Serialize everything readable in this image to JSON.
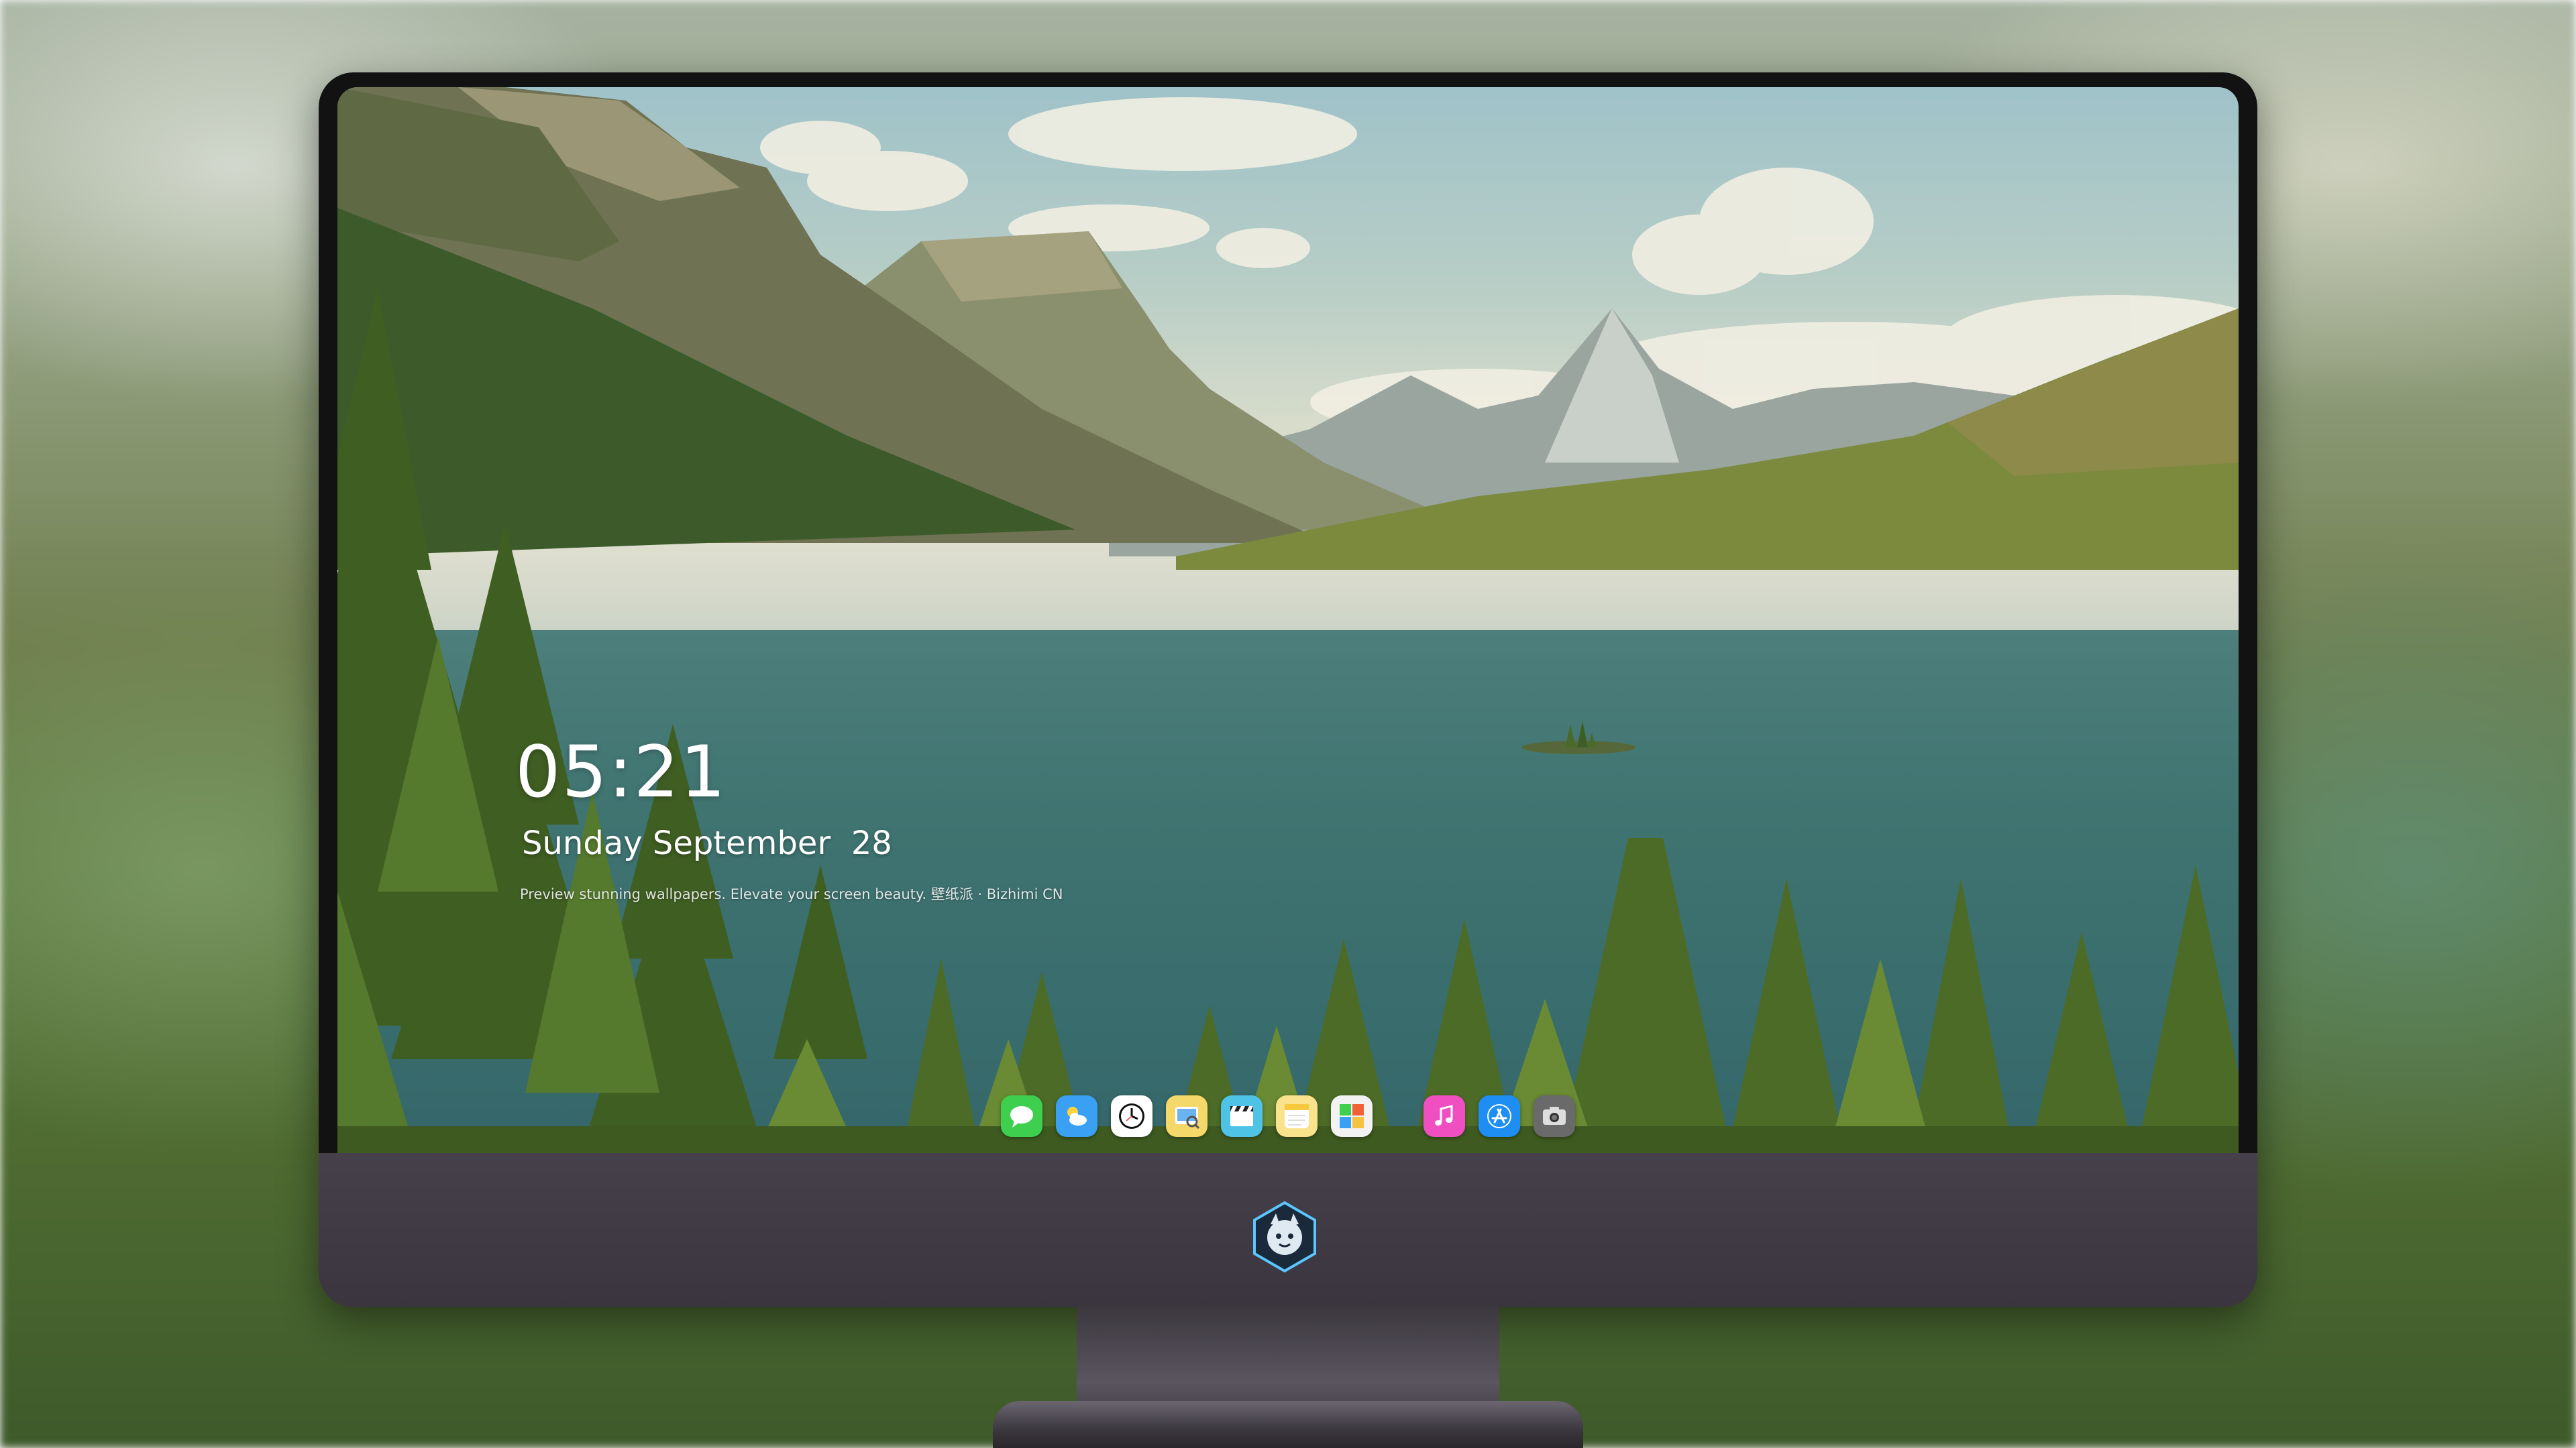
{
  "lock_screen": {
    "time": "05:21",
    "date": "Sunday September  28",
    "tagline": "Preview stunning wallpapers. Elevate your screen beauty. 壁纸派 · Bizhimi CN"
  },
  "dock": {
    "items": [
      {
        "name": "messages",
        "icon": "chat-bubble-icon",
        "color": "#3ecf4f"
      },
      {
        "name": "weather",
        "icon": "cloud-sun-icon",
        "color": "#3aa0f3"
      },
      {
        "name": "clock",
        "icon": "clock-icon",
        "color": "#ffffff"
      },
      {
        "name": "preview",
        "icon": "preview-icon",
        "color": "#f4d86a"
      },
      {
        "name": "clips",
        "icon": "clapperboard-icon",
        "color": "#4fc3e6"
      },
      {
        "name": "notes",
        "icon": "notes-icon",
        "color": "#fbe38e"
      },
      {
        "name": "photo-collage",
        "icon": "collage-icon",
        "color": "#f2f2f2"
      },
      {
        "name": "music",
        "icon": "music-note-icon",
        "color": "#f04fc2"
      },
      {
        "name": "app-store",
        "icon": "app-store-icon",
        "color": "#1e8ef5"
      },
      {
        "name": "camera",
        "icon": "camera-icon",
        "color": "#6a6a6a"
      }
    ]
  }
}
